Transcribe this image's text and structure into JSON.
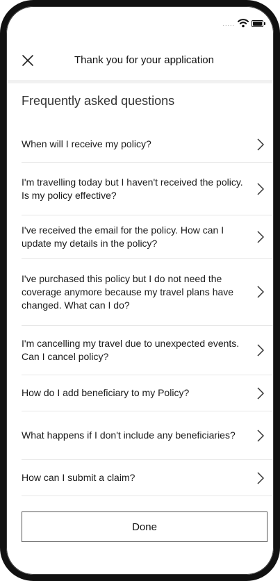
{
  "header": {
    "title": "Thank you for your application",
    "close_icon": "close-icon"
  },
  "status_bar": {
    "signal": ".....",
    "icons": [
      "wifi-icon",
      "battery-icon"
    ]
  },
  "faq": {
    "title": "Frequently asked questions",
    "items": [
      {
        "text": "When will I receive my policy?",
        "icon": "chevron-right-icon"
      },
      {
        "text": "I'm travelling today but I haven't received the policy. Is my policy effective?",
        "icon": "chevron-right-icon"
      },
      {
        "text": "I've received the email for the policy. How can I update my details in the policy?",
        "icon": "chevron-right-icon"
      },
      {
        "text": "I've purchased this policy but I do not need the coverage anymore because my travel plans have changed. What can I do?",
        "icon": "chevron-right-icon"
      },
      {
        "text": "I'm cancelling my travel due to unexpected events. Can I cancel policy?",
        "icon": "chevron-right-icon"
      },
      {
        "text": "How do I add beneficiary to my Policy?",
        "icon": "chevron-right-icon"
      },
      {
        "text": "What happens if I don't include any beneficiaries?",
        "icon": "chevron-right-icon"
      },
      {
        "text": "How can I submit a claim?",
        "icon": "chevron-right-icon"
      }
    ]
  },
  "footer": {
    "done_label": "Done"
  }
}
